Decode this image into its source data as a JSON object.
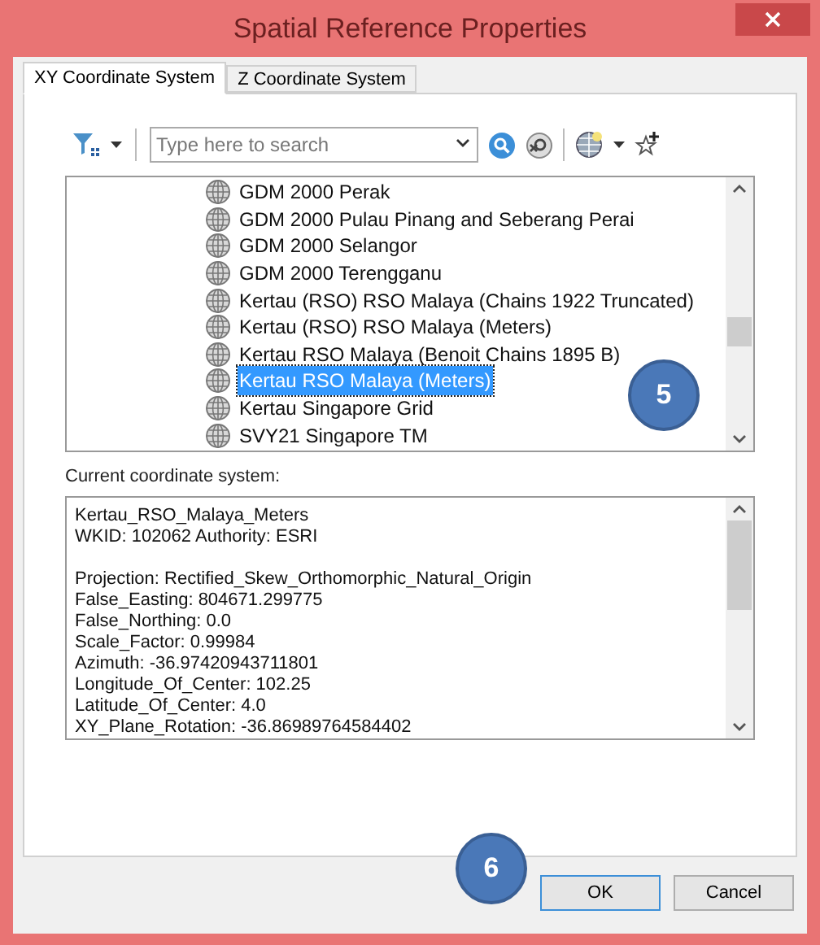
{
  "window": {
    "title": "Spatial Reference Properties"
  },
  "tabs": [
    {
      "label": "XY Coordinate System",
      "selected": true
    },
    {
      "label": "Z Coordinate System",
      "selected": false
    }
  ],
  "search": {
    "placeholder": "Type here to search"
  },
  "list": {
    "callout": "5",
    "items": [
      {
        "label": "GDM 2000 Perak",
        "selected": false
      },
      {
        "label": "GDM 2000 Pulau Pinang and Seberang Perai",
        "selected": false
      },
      {
        "label": "GDM 2000 Selangor",
        "selected": false
      },
      {
        "label": "GDM 2000 Terengganu",
        "selected": false
      },
      {
        "label": "Kertau (RSO) RSO Malaya (Chains 1922 Truncated)",
        "selected": false
      },
      {
        "label": "Kertau (RSO) RSO Malaya (Meters)",
        "selected": false
      },
      {
        "label": "Kertau RSO Malaya (Benoit Chains 1895 B)",
        "selected": false
      },
      {
        "label": "Kertau RSO Malaya (Meters)",
        "selected": true
      },
      {
        "label": "Kertau Singapore Grid",
        "selected": false
      },
      {
        "label": "SVY21 Singapore TM",
        "selected": false
      }
    ]
  },
  "current": {
    "label": "Current coordinate system:",
    "blocks": [
      [
        "Kertau_RSO_Malaya_Meters",
        "WKID: 102062 Authority: ESRI"
      ],
      [
        "Projection: Rectified_Skew_Orthomorphic_Natural_Origin",
        "False_Easting: 804671.299775",
        "False_Northing: 0.0",
        "Scale_Factor: 0.99984",
        "Azimuth: -36.97420943711801",
        "Longitude_Of_Center: 102.25",
        "Latitude_Of_Center: 4.0",
        "XY_Plane_Rotation: -36.86989764584402"
      ]
    ]
  },
  "footer": {
    "callout": "6",
    "buttons": [
      {
        "label": "OK",
        "default": true
      },
      {
        "label": "Cancel",
        "default": false
      }
    ]
  }
}
